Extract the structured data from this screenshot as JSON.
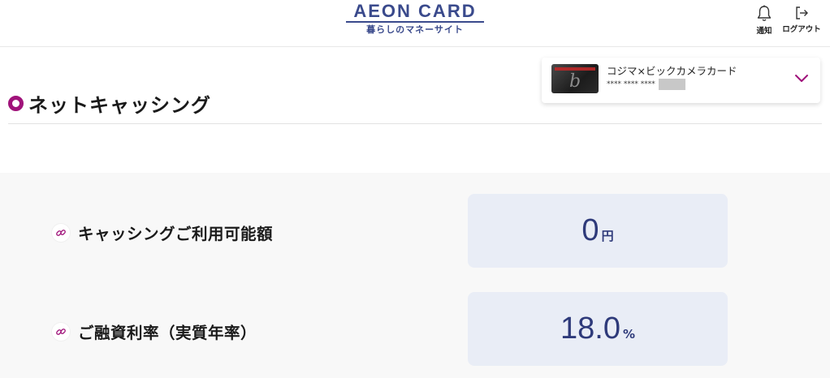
{
  "header": {
    "logo_main": "AEON CARD",
    "logo_sub": "暮らしのマネーサイト",
    "notify_label": "通知",
    "logout_label": "ログアウト"
  },
  "page": {
    "title": "ネットキャッシング"
  },
  "card": {
    "name": "コジマ×ビックカメラカード",
    "number_masked": "**** **** ****"
  },
  "rows": [
    {
      "label": "キャッシングご利用可能額",
      "value": "0",
      "unit": "円"
    },
    {
      "label": "ご融資利率（実質年率）",
      "value": "18.0",
      "unit": "%"
    }
  ],
  "colors": {
    "brand_navy": "#3a4a8c",
    "accent_magenta": "#a0137a",
    "value_text": "#2e3a7a",
    "value_box_bg": "#e9edf6"
  },
  "icons": [
    "bell-icon",
    "logout-icon",
    "chevron-down-icon",
    "link-icon"
  ]
}
